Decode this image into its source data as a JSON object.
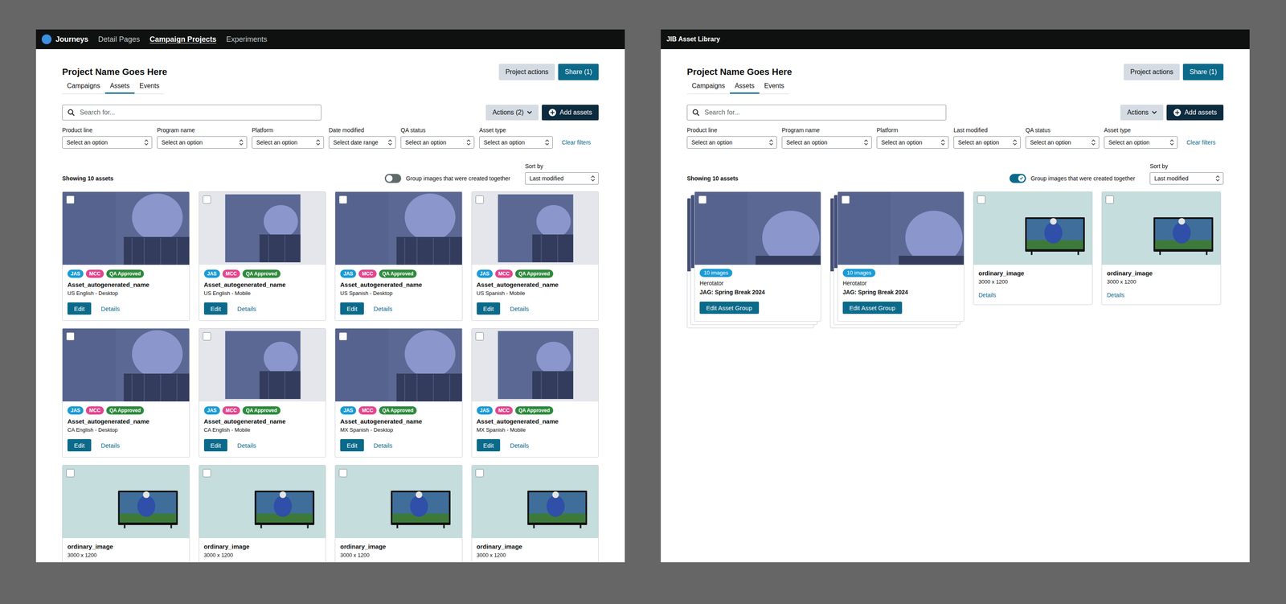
{
  "panels": [
    {
      "logo": true,
      "brand": "Journeys",
      "nav_items": [
        {
          "label": "Detail Pages",
          "selected": false
        },
        {
          "label": "Campaign Projects",
          "selected": true
        },
        {
          "label": "Experiments",
          "selected": false
        }
      ],
      "title": "Project Name Goes Here",
      "header_buttons": [
        {
          "label": "Project actions",
          "kind": "secondary"
        },
        {
          "label": "Share (1)",
          "kind": "primary"
        }
      ],
      "tabs": [
        {
          "label": "Campaigns",
          "selected": false
        },
        {
          "label": "Assets",
          "selected": true
        },
        {
          "label": "Events",
          "selected": false
        }
      ],
      "search": {
        "placeholder": "Search for..."
      },
      "actions_button": "Actions (2)",
      "add_button": "Add assets",
      "filters": [
        {
          "label": "Product line",
          "value": "Select an option"
        },
        {
          "label": "Program name",
          "value": "Select an option"
        },
        {
          "label": "Platform",
          "value": "Select an option"
        },
        {
          "label": "Date modified",
          "value": "Select date range"
        },
        {
          "label": "QA status",
          "value": "Select an option"
        },
        {
          "label": "Asset type",
          "value": "Select an option"
        }
      ],
      "clear_filters": "Clear filters",
      "count": "Showing 10 assets",
      "group_toggle": {
        "label": "Group images that were created together",
        "on": false
      },
      "sort": {
        "label": "Sort by",
        "value": "Last modified"
      },
      "cards": [
        {
          "kind": "asset",
          "thumb": "desktop",
          "checked": false,
          "tags": [
            {
              "label": "JAS",
              "color": "#1a9bd7"
            },
            {
              "label": "MCC",
              "color": "#e4468f"
            },
            {
              "label": "QA Approved",
              "color": "#2e8b3d"
            }
          ],
          "name": "Asset_autogenerated_name",
          "sub": "US English - Desktop",
          "edit": "Edit",
          "details": "Details"
        },
        {
          "kind": "asset",
          "thumb": "mobile",
          "checked": false,
          "tags": [
            {
              "label": "JAS",
              "color": "#1a9bd7"
            },
            {
              "label": "MCC",
              "color": "#e4468f"
            },
            {
              "label": "QA Approved",
              "color": "#2e8b3d"
            }
          ],
          "name": "Asset_autogenerated_name",
          "sub": "US English - Mobile",
          "edit": "Edit",
          "details": "Details"
        },
        {
          "kind": "asset",
          "thumb": "desktop",
          "checked": false,
          "tags": [
            {
              "label": "JAS",
              "color": "#1a9bd7"
            },
            {
              "label": "MCC",
              "color": "#e4468f"
            },
            {
              "label": "QA Approved",
              "color": "#2e8b3d"
            }
          ],
          "name": "Asset_autogenerated_name",
          "sub": "US Spanish - Desktop",
          "edit": "Edit",
          "details": "Details"
        },
        {
          "kind": "asset",
          "thumb": "mobile",
          "checked": false,
          "tags": [
            {
              "label": "JAS",
              "color": "#1a9bd7"
            },
            {
              "label": "MCC",
              "color": "#e4468f"
            },
            {
              "label": "QA Approved",
              "color": "#2e8b3d"
            }
          ],
          "name": "Asset_autogenerated_name",
          "sub": "US Spanish - Mobile",
          "edit": "Edit",
          "details": "Details"
        },
        {
          "kind": "asset",
          "thumb": "desktop",
          "checked": false,
          "tags": [
            {
              "label": "JAS",
              "color": "#1a9bd7"
            },
            {
              "label": "MCC",
              "color": "#e4468f"
            },
            {
              "label": "QA Approved",
              "color": "#2e8b3d"
            }
          ],
          "name": "Asset_autogenerated_name",
          "sub": "CA English - Desktop",
          "edit": "Edit",
          "details": "Details"
        },
        {
          "kind": "asset",
          "thumb": "mobile",
          "checked": false,
          "tags": [
            {
              "label": "JAS",
              "color": "#1a9bd7"
            },
            {
              "label": "MCC",
              "color": "#e4468f"
            },
            {
              "label": "QA Approved",
              "color": "#2e8b3d"
            }
          ],
          "name": "Asset_autogenerated_name",
          "sub": "CA English - Mobile",
          "edit": "Edit",
          "details": "Details"
        },
        {
          "kind": "asset",
          "thumb": "desktop",
          "checked": false,
          "tags": [
            {
              "label": "JAS",
              "color": "#1a9bd7"
            },
            {
              "label": "MCC",
              "color": "#e4468f"
            },
            {
              "label": "QA Approved",
              "color": "#2e8b3d"
            }
          ],
          "name": "Asset_autogenerated_name",
          "sub": "MX Spanish - Desktop",
          "edit": "Edit",
          "details": "Details"
        },
        {
          "kind": "asset",
          "thumb": "mobile",
          "checked": false,
          "tags": [
            {
              "label": "JAS",
              "color": "#1a9bd7"
            },
            {
              "label": "MCC",
              "color": "#e4468f"
            },
            {
              "label": "QA Approved",
              "color": "#2e8b3d"
            }
          ],
          "name": "Asset_autogenerated_name",
          "sub": "MX Spanish - Mobile",
          "edit": "Edit",
          "details": "Details"
        },
        {
          "kind": "single",
          "thumb": "tv",
          "checked": false,
          "name": "ordinary_image",
          "dims": "3000 x 1200"
        },
        {
          "kind": "single",
          "thumb": "tv",
          "checked": false,
          "name": "ordinary_image",
          "dims": "3000 x 1200"
        },
        {
          "kind": "single",
          "thumb": "tv",
          "checked": false,
          "name": "ordinary_image",
          "dims": "3000 x 1200"
        },
        {
          "kind": "single",
          "thumb": "tv",
          "checked": false,
          "name": "ordinary_image",
          "dims": "3000 x 1200"
        }
      ]
    },
    {
      "logo": false,
      "brand": "JIB Asset Library",
      "nav_items": [],
      "title": "Project Name Goes Here",
      "header_buttons": [
        {
          "label": "Project actions",
          "kind": "secondary"
        },
        {
          "label": "Share (1)",
          "kind": "primary"
        }
      ],
      "tabs": [
        {
          "label": "Campaigns",
          "selected": false
        },
        {
          "label": "Assets",
          "selected": true
        },
        {
          "label": "Events",
          "selected": false
        }
      ],
      "search": {
        "placeholder": "Search for..."
      },
      "actions_button": "Actions",
      "add_button": "Add assets",
      "filters": [
        {
          "label": "Product line",
          "value": "Select an option"
        },
        {
          "label": "Program name",
          "value": "Select an option"
        },
        {
          "label": "Platform",
          "value": "Select an option"
        },
        {
          "label": "Last modified",
          "value": "Select an option"
        },
        {
          "label": "QA status",
          "value": "Select an option"
        },
        {
          "label": "Asset type",
          "value": "Select an option"
        }
      ],
      "clear_filters": "Clear filters",
      "count": "Showing 10 assets",
      "group_toggle": {
        "label": "Group images that were created together",
        "on": true
      },
      "sort": {
        "label": "Sort by",
        "value": "Last modified"
      },
      "cards": [
        {
          "kind": "group",
          "thumb": "group",
          "checked": false,
          "badge": "10 images",
          "type": "Herotator",
          "name": "JAG: Spring Break 2024",
          "button": "Edit Asset Group"
        },
        {
          "kind": "group",
          "thumb": "group",
          "checked": false,
          "badge": "10 images",
          "type": "Herotator",
          "name": "JAG: Spring Break 2024",
          "button": "Edit Asset Group"
        },
        {
          "kind": "single",
          "thumb": "tv",
          "checked": false,
          "name": "ordinary_image",
          "dims": "3000 x 1200",
          "details": "Details"
        },
        {
          "kind": "single",
          "thumb": "tv",
          "checked": false,
          "name": "ordinary_image",
          "dims": "3000 x 1200",
          "details": "Details"
        }
      ]
    }
  ]
}
